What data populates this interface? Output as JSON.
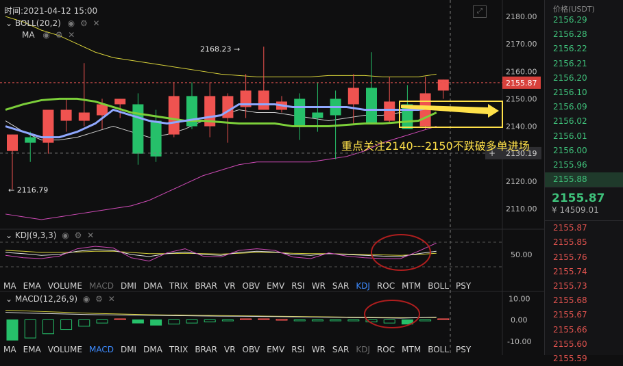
{
  "header": {
    "time_label": "时间:2021-04-12 15:00",
    "boll_label": "BOLL(20,2)",
    "ma_label": "MA",
    "kdj_label": "KDJ(9,3,3)",
    "macd_label": "MACD(12,26,9)"
  },
  "annotation": {
    "text": "重点关注2140---2150不跌破多单进场",
    "color": "#ffe14a"
  },
  "colors": {
    "up": "#ef5350",
    "down": "#26c06a",
    "ma_green": "#7ccf3a",
    "ma_blue": "#8fa8ff",
    "boll_yellow": "#d8d23a",
    "boll_pink": "#d04bb8",
    "bg": "#0f0f10"
  },
  "chart_data": [
    {
      "type": "candlestick",
      "name": "main",
      "ylim": [
        2103,
        2186
      ],
      "yticks": [
        2180,
        2170,
        2160,
        2150,
        2140,
        2130,
        2120,
        2110
      ],
      "ytick_labels": [
        "2180.00",
        "2170.00",
        "2160.00",
        "2150.00",
        "2140.00",
        "2130.00",
        "2120.00",
        "2110.00"
      ],
      "current_price_label": "2155.87",
      "current_price": 2155.87,
      "crosshair_label": "2130.19",
      "crosshair_price": 2130.19,
      "high_label": "2168.23",
      "low_label": "2116.79",
      "candles": [
        {
          "o": 2131,
          "h": 2137,
          "l": 2117,
          "c": 2137
        },
        {
          "o": 2136,
          "h": 2138,
          "l": 2127,
          "c": 2134
        },
        {
          "o": 2134,
          "h": 2144,
          "l": 2130,
          "c": 2146
        },
        {
          "o": 2142,
          "h": 2150,
          "l": 2138,
          "c": 2146
        },
        {
          "o": 2142,
          "h": 2163,
          "l": 2140,
          "c": 2145
        },
        {
          "o": 2144,
          "h": 2150,
          "l": 2139,
          "c": 2148
        },
        {
          "o": 2148,
          "h": 2150,
          "l": 2143,
          "c": 2150
        },
        {
          "o": 2148,
          "h": 2152,
          "l": 2126,
          "c": 2130
        },
        {
          "o": 2142,
          "h": 2146,
          "l": 2127,
          "c": 2129
        },
        {
          "o": 2137,
          "h": 2156,
          "l": 2136,
          "c": 2151
        },
        {
          "o": 2151,
          "h": 2156,
          "l": 2139,
          "c": 2140
        },
        {
          "o": 2140,
          "h": 2156,
          "l": 2136,
          "c": 2151
        },
        {
          "o": 2143,
          "h": 2152,
          "l": 2134,
          "c": 2151
        },
        {
          "o": 2147,
          "h": 2159,
          "l": 2143,
          "c": 2153
        },
        {
          "o": 2146,
          "h": 2169,
          "l": 2146,
          "c": 2153
        },
        {
          "o": 2146,
          "h": 2151,
          "l": 2145,
          "c": 2149
        },
        {
          "o": 2150,
          "h": 2152,
          "l": 2135,
          "c": 2140
        },
        {
          "o": 2145,
          "h": 2156,
          "l": 2138,
          "c": 2143
        },
        {
          "o": 2150,
          "h": 2153,
          "l": 2128,
          "c": 2144
        },
        {
          "o": 2148,
          "h": 2159,
          "l": 2141,
          "c": 2154
        },
        {
          "o": 2154,
          "h": 2167,
          "l": 2141,
          "c": 2141
        },
        {
          "o": 2142,
          "h": 2158,
          "l": 2141,
          "c": 2149
        },
        {
          "o": 2148,
          "h": 2155,
          "l": 2140,
          "c": 2139
        },
        {
          "o": 2140,
          "h": 2158,
          "l": 2139,
          "c": 2152
        },
        {
          "o": 2153,
          "h": 2157,
          "l": 2150,
          "c": 2157
        }
      ],
      "boll_upper": [
        2180,
        2178,
        2175,
        2173,
        2170,
        2167,
        2165,
        2164,
        2163,
        2162,
        2161,
        2160,
        2159,
        2158.5,
        2158,
        2158,
        2158,
        2158,
        2158.5,
        2158.5,
        2158.5,
        2158,
        2158,
        2158,
        2159
      ],
      "boll_lower": [
        2108,
        2107,
        2106,
        2107,
        2108,
        2109,
        2110,
        2111,
        2113,
        2116,
        2119,
        2122,
        2124,
        2126,
        2127,
        2127,
        2127,
        2127,
        2128,
        2129,
        2131,
        2134,
        2136,
        2138,
        2140
      ],
      "ma_green": [
        2146,
        2148,
        2149.5,
        2150,
        2150,
        2149,
        2147,
        2145,
        2144,
        2143,
        2142,
        2142,
        2141.5,
        2141,
        2141,
        2141,
        2140,
        2140,
        2140,
        2140.5,
        2141,
        2141,
        2141.5,
        2142,
        2145
      ],
      "ma_blue": [
        2140,
        2138,
        2136,
        2136,
        2138,
        2141,
        2146,
        2144,
        2142,
        2141,
        2142,
        2143,
        2144,
        2148,
        2148,
        2148,
        2147,
        2147,
        2147,
        2147,
        2146,
        2146,
        2146,
        2146,
        2147
      ],
      "ma_white": [
        2142,
        2138,
        2135,
        2135,
        2136,
        2138,
        2140,
        2138,
        2136,
        2137,
        2139,
        2142,
        2144,
        2146,
        2145,
        2145,
        2144,
        2143,
        2142,
        2143,
        2144,
        2144,
        2145,
        2146,
        2147
      ]
    },
    {
      "type": "line",
      "name": "KDJ",
      "ylim": [
        0,
        100
      ],
      "ytick_labels": [
        "50.00"
      ],
      "k": [
        55,
        52,
        48,
        50,
        58,
        62,
        60,
        50,
        45,
        52,
        56,
        50,
        48,
        55,
        58,
        56,
        50,
        48,
        52,
        50,
        48,
        46,
        45,
        52,
        58
      ],
      "d": [
        60,
        58,
        55,
        55,
        56,
        58,
        58,
        55,
        52,
        52,
        53,
        52,
        51,
        53,
        55,
        55,
        53,
        52,
        52,
        51,
        50,
        49,
        48,
        50,
        53
      ],
      "j": [
        48,
        42,
        40,
        46,
        64,
        70,
        66,
        42,
        34,
        54,
        64,
        46,
        44,
        60,
        64,
        60,
        44,
        40,
        54,
        46,
        42,
        40,
        40,
        58,
        78
      ]
    },
    {
      "type": "bar",
      "name": "MACD",
      "ylim": [
        -12,
        12
      ],
      "ytick_labels": [
        "10.00",
        "0.00",
        "-10.00"
      ],
      "histogram": [
        -9.5,
        -8.5,
        -6.5,
        -4.5,
        -3,
        -1.5,
        0.5,
        -1.5,
        -2.5,
        -2,
        -1.5,
        -1,
        -0.5,
        0.5,
        0.5,
        0.3,
        -0.3,
        -0.5,
        -0.3,
        -0.5,
        -1,
        -1.5,
        -2,
        -0.5,
        0.5
      ],
      "dif": [
        3.5,
        3.2,
        3,
        2.8,
        2.6,
        2.4,
        2.3,
        2.2,
        2.1,
        2,
        1.9,
        1.8,
        1.7,
        1.7,
        1.6,
        1.5,
        1.4,
        1.3,
        1.2,
        1.1,
        1,
        0.9,
        0.8,
        1,
        1.3
      ],
      "dea": [
        4.5,
        4.2,
        3.9,
        3.6,
        3.3,
        3,
        2.8,
        2.6,
        2.4,
        2.3,
        2.2,
        2.1,
        2,
        1.9,
        1.8,
        1.7,
        1.6,
        1.5,
        1.4,
        1.3,
        1.2,
        1.1,
        1,
        1,
        1.1
      ]
    }
  ],
  "indicator_tabs_1": [
    "MA",
    "EMA",
    "VOLUME",
    "MACD",
    "DMI",
    "DMA",
    "TRIX",
    "BRAR",
    "VR",
    "OBV",
    "EMV",
    "RSI",
    "WR",
    "SAR",
    "KDJ",
    "ROC",
    "MTM",
    "BOLL",
    "PSY"
  ],
  "indicator_tabs_1_active": "KDJ",
  "indicator_tabs_1_muted": "MACD",
  "indicator_tabs_2": [
    "MA",
    "EMA",
    "VOLUME",
    "MACD",
    "DMI",
    "DMA",
    "TRIX",
    "BRAR",
    "VR",
    "OBV",
    "EMV",
    "RSI",
    "WR",
    "SAR",
    "KDJ",
    "ROC",
    "MTM",
    "BOLL",
    "PSY"
  ],
  "indicator_tabs_2_active": "MACD",
  "indicator_tabs_2_muted": "KDJ",
  "ladder": {
    "header": "价格(USDT)",
    "bids": [
      "2156.29",
      "2156.28",
      "2156.22",
      "2156.21",
      "2156.20",
      "2156.10",
      "2156.09",
      "2156.02",
      "2156.01",
      "2156.00",
      "2155.96",
      "2155.88"
    ],
    "last_price": "2155.87",
    "last_price_cny": "¥ 14509.01",
    "asks": [
      "2155.87",
      "2155.85",
      "2155.76",
      "2155.74",
      "2155.73",
      "2155.68",
      "2155.67",
      "2155.66",
      "2155.60",
      "2155.59"
    ]
  }
}
